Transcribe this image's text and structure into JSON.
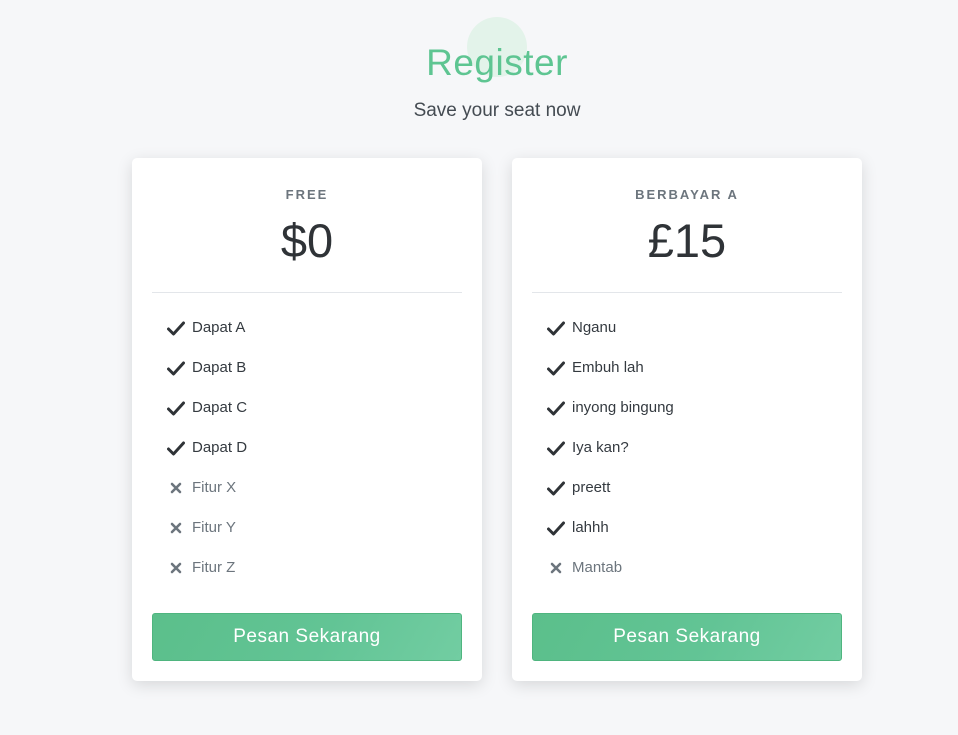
{
  "header": {
    "title": "Register",
    "subtitle": "Save your seat now"
  },
  "plans": [
    {
      "name": "FREE",
      "price": "$0",
      "features": [
        {
          "label": "Dapat A",
          "included": true
        },
        {
          "label": "Dapat B",
          "included": true
        },
        {
          "label": "Dapat C",
          "included": true
        },
        {
          "label": "Dapat D",
          "included": true
        },
        {
          "label": "Fitur X",
          "included": false
        },
        {
          "label": "Fitur Y",
          "included": false
        },
        {
          "label": "Fitur Z",
          "included": false
        }
      ],
      "button_label": "Pesan Sekarang"
    },
    {
      "name": "BERBAYAR A",
      "price": "£15",
      "features": [
        {
          "label": "Nganu",
          "included": true
        },
        {
          "label": "Embuh lah",
          "included": true
        },
        {
          "label": "inyong bingung",
          "included": true
        },
        {
          "label": "Iya kan?",
          "included": true
        },
        {
          "label": "preett",
          "included": true
        },
        {
          "label": "lahhh",
          "included": true
        },
        {
          "label": "Mantab",
          "included": false
        }
      ],
      "button_label": "Pesan Sekarang"
    }
  ],
  "icons": {
    "included": "check-icon",
    "excluded": "times-icon"
  },
  "colors": {
    "accent": "#5ec592",
    "button": "#62c495",
    "background": "#f6f7f9",
    "excluded_icon": "#6c757d",
    "included_icon": "#2f3337"
  }
}
